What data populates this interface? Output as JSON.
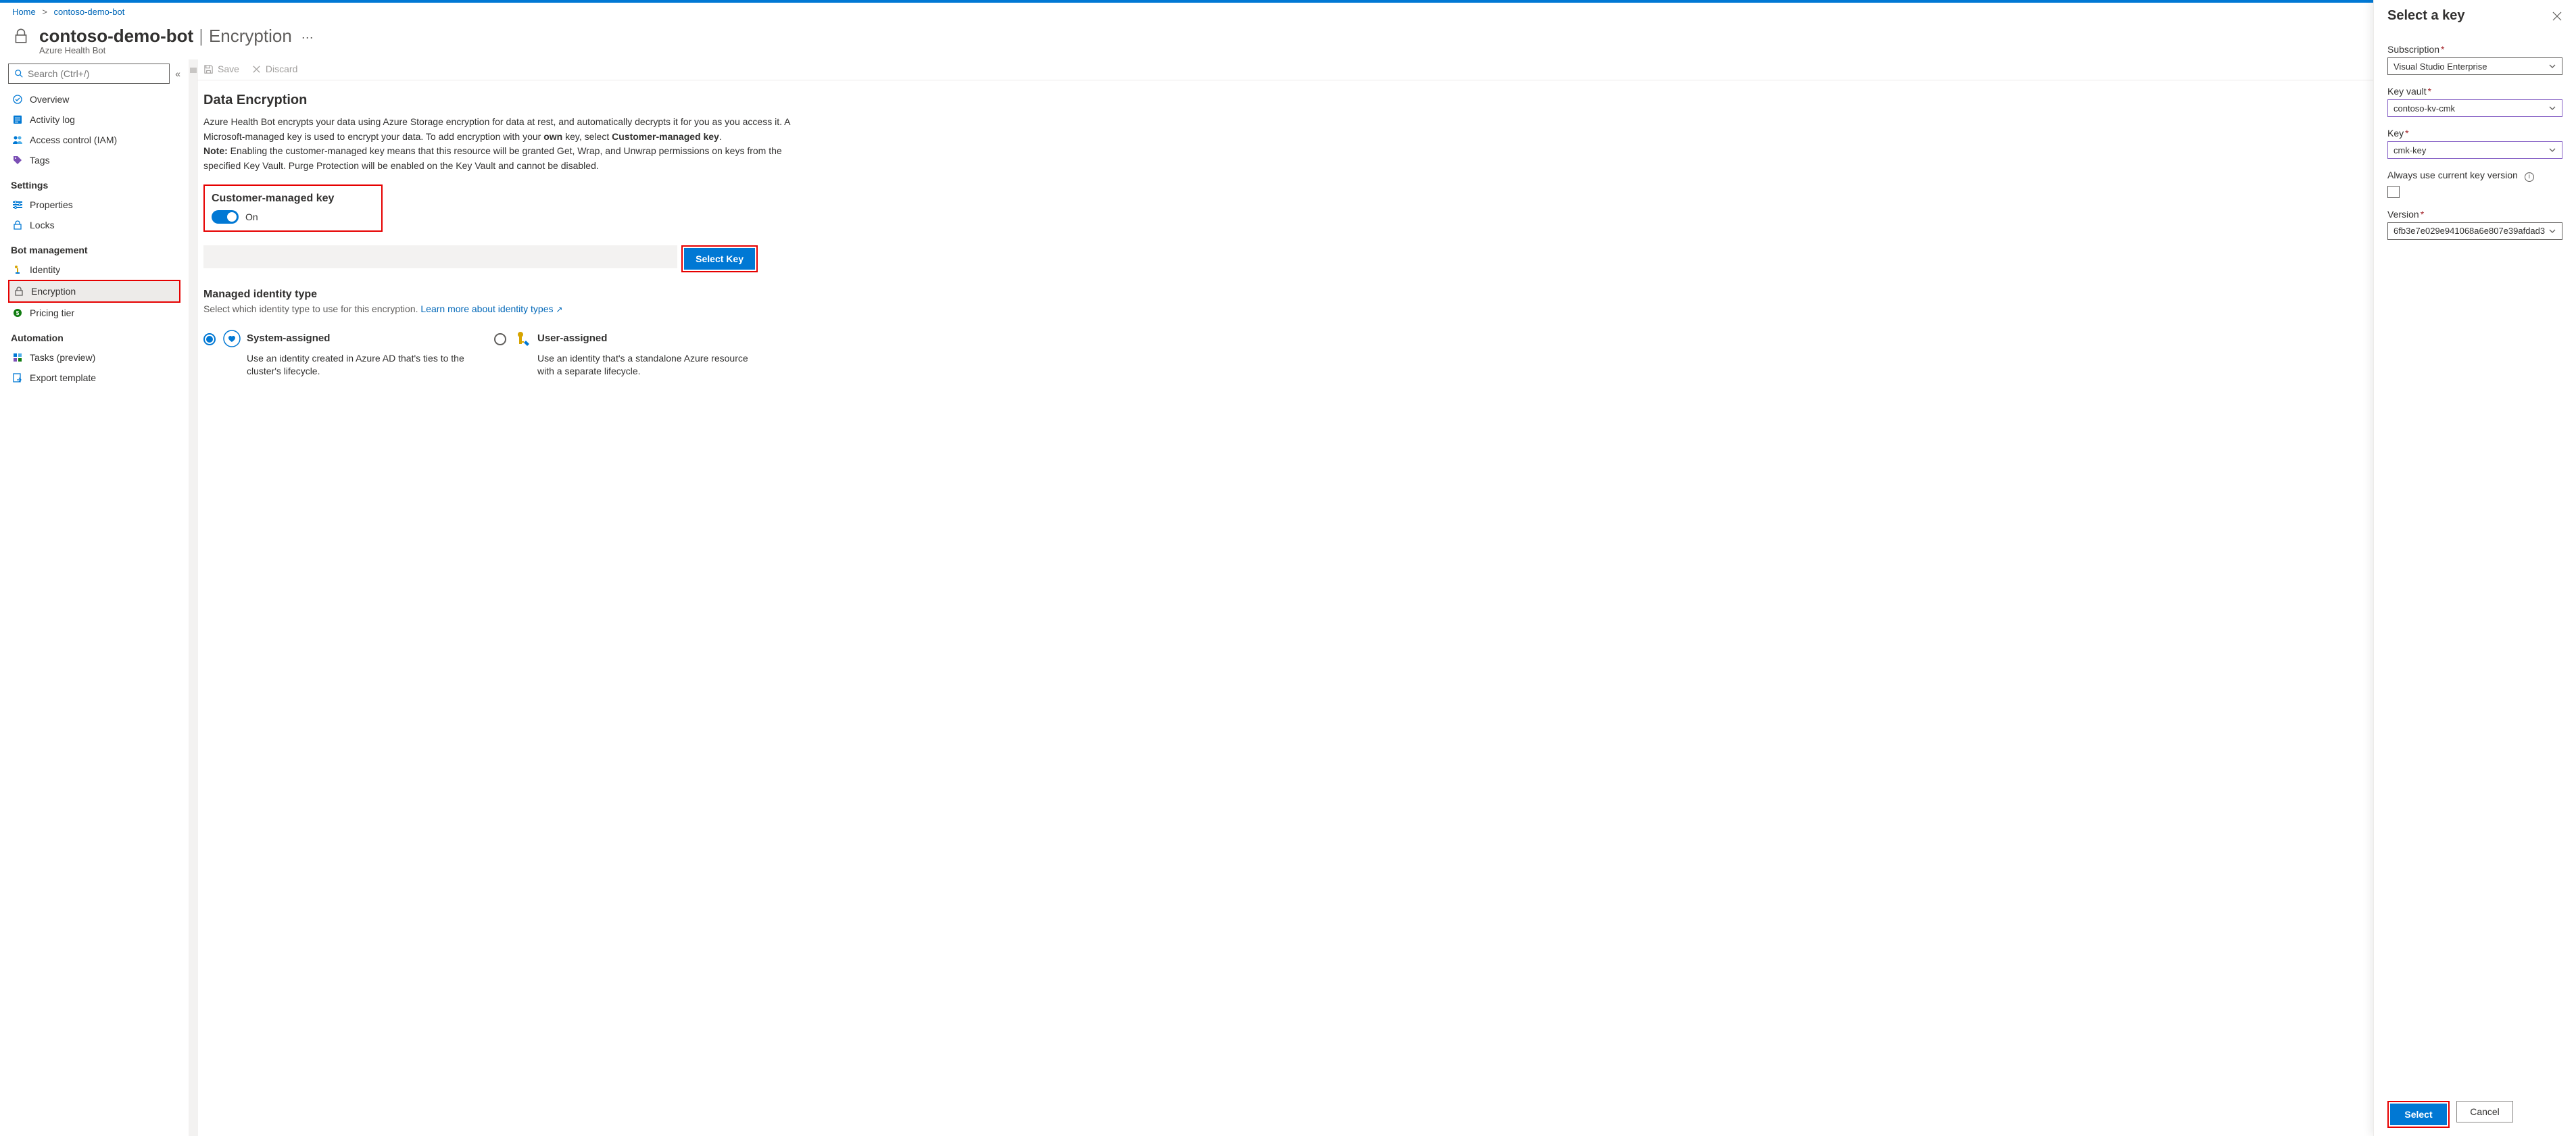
{
  "breadcrumb": {
    "home": "Home",
    "resource": "contoso-demo-bot"
  },
  "header": {
    "title": "contoso-demo-bot",
    "page": "Encryption",
    "subtitle": "Azure Health Bot"
  },
  "search": {
    "placeholder": "Search (Ctrl+/)"
  },
  "sidebar": {
    "items": [
      {
        "label": "Overview"
      },
      {
        "label": "Activity log"
      },
      {
        "label": "Access control (IAM)"
      },
      {
        "label": "Tags"
      }
    ],
    "settings_label": "Settings",
    "settings": [
      {
        "label": "Properties"
      },
      {
        "label": "Locks"
      }
    ],
    "bot_label": "Bot management",
    "bot": [
      {
        "label": "Identity"
      },
      {
        "label": "Encryption"
      },
      {
        "label": "Pricing tier"
      }
    ],
    "automation_label": "Automation",
    "automation": [
      {
        "label": "Tasks (preview)"
      },
      {
        "label": "Export template"
      }
    ]
  },
  "toolbar": {
    "save": "Save",
    "discard": "Discard"
  },
  "encryption": {
    "heading": "Data Encryption",
    "desc1": "Azure Health Bot encrypts your data using Azure Storage encryption for data at rest, and automatically decrypts it for you as you access it. A Microsoft-managed key is used to encrypt your data. To add encryption with your ",
    "desc_own": "own",
    "desc2": " key, select ",
    "desc_cmk": "Customer-managed key",
    "desc3": ".",
    "note_label": "Note:",
    "note": " Enabling the customer-managed key means that this resource will be granted Get, Wrap, and Unwrap permissions on keys from the specified Key Vault. Purge Protection will be enabled on the Key Vault and cannot be disabled.",
    "cmk_label": "Customer-managed key",
    "toggle_state": "On",
    "select_key_btn": "Select Key",
    "identity_heading": "Managed identity type",
    "identity_sub": "Select which identity type to use for this encryption.",
    "identity_link": "Learn more about identity types",
    "opt_system": "System-assigned",
    "opt_system_desc": "Use an identity created in Azure AD that's ties to the cluster's lifecycle.",
    "opt_user": "User-assigned",
    "opt_user_desc": "Use an identity that's a standalone Azure resource with a separate lifecycle."
  },
  "panel": {
    "title": "Select a key",
    "subscription_label": "Subscription",
    "subscription_value": "Visual Studio Enterprise",
    "keyvault_label": "Key vault",
    "keyvault_value": "contoso-kv-cmk",
    "key_label": "Key",
    "key_value": "cmk-key",
    "always_label": "Always use current key version",
    "version_label": "Version",
    "version_value": "6fb3e7e029e941068a6e807e39afdad3",
    "select_btn": "Select",
    "cancel_btn": "Cancel"
  }
}
